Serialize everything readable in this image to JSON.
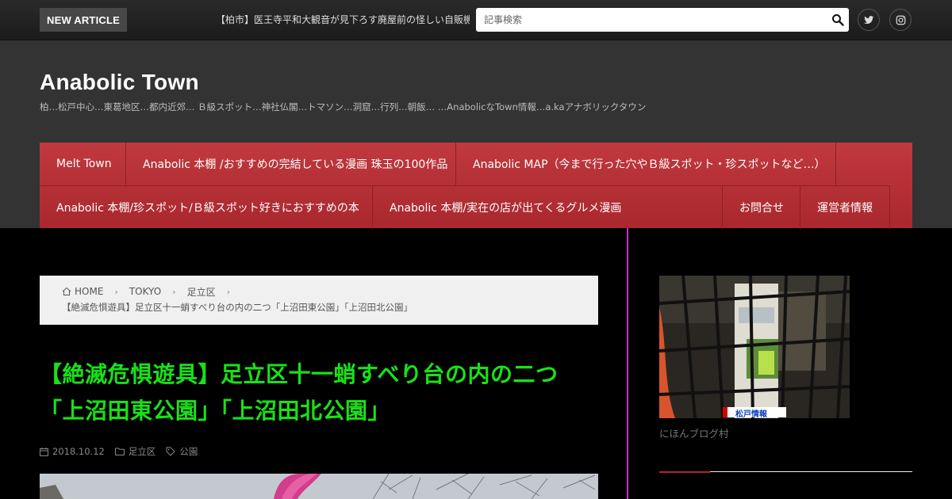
{
  "topbar": {
    "new_article_label": "NEW ARTICLE",
    "ticker_text": "【柏市】医王寺平和大観音が見下ろす廃屋前の怪しい自販機",
    "search_placeholder": "記事検索",
    "social": [
      "twitter-icon",
      "instagram-icon"
    ]
  },
  "header": {
    "site_title": "Anabolic Town",
    "site_description": "柏…松戸中心…東葛地区…都内近郊… Ｂ級スポット…神社仏閣…トマソン…洞窟…行列…朝飯… …AnabolicなTown情報…a.kaアナボリックタウン"
  },
  "nav": {
    "row1": [
      "Melt Town",
      "Anabolic 本棚 /おすすめの完結している漫画 珠玉の100作品",
      "Anabolic MAP（今まで行った穴やＢ級スポット・珍スポットなど…）"
    ],
    "row2": [
      "Anabolic 本棚/珍スポット/Ｂ級スポット好きにおすすめの本",
      "Anabolic 本棚/実在の店が出てくるグルメ漫画",
      "お問合せ",
      "運営者情報"
    ]
  },
  "breadcrumb": {
    "home": "HOME",
    "level1": "TOKYO",
    "level2": "足立区",
    "current": "【絶滅危惧遊具】足立区十一蛸すべり台の内の二つ「上沼田東公園」「上沼田北公園」"
  },
  "post": {
    "title": "【絶滅危惧遊具】足立区十一蛸すべり台の内の二つ「上沼田東公園」「上沼田北公園」",
    "date": "2018.10.12",
    "category": "足立区",
    "tag": "公園"
  },
  "sidebar": {
    "banner_label": "松戸情報",
    "banner_caption": "にほんブログ村"
  },
  "colors": {
    "nav_red": "#b3323a",
    "title_green": "#17e217",
    "divider_magenta": "#d02ad0"
  }
}
